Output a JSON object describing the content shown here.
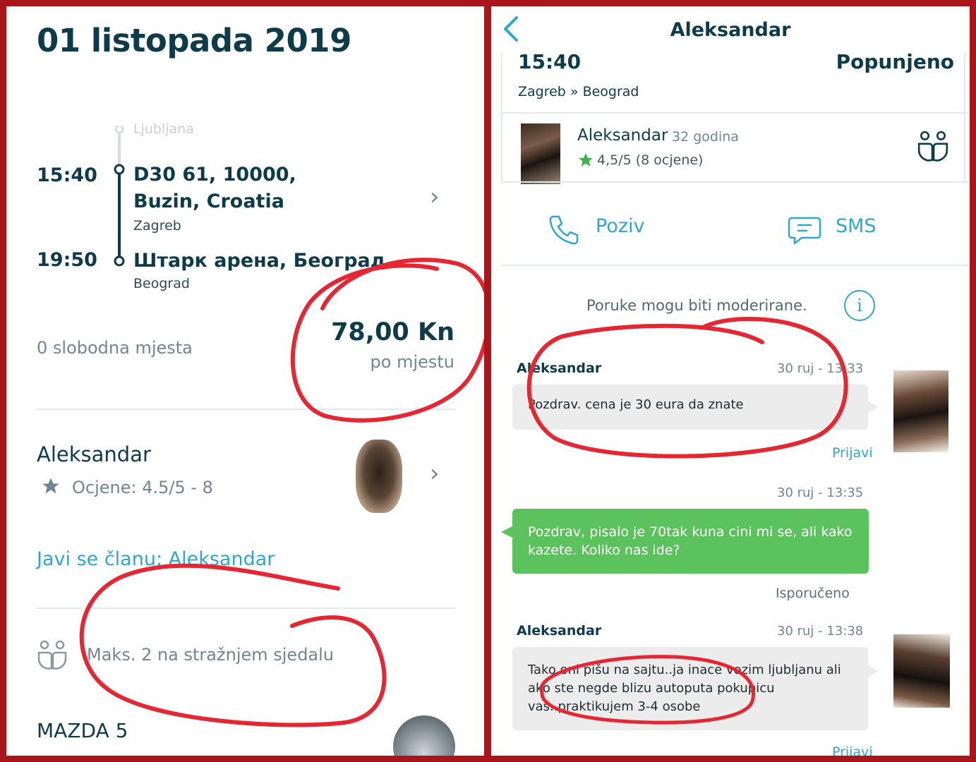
{
  "left": {
    "date_title": "01 listopada 2019",
    "route": {
      "origin_prev": "Ljubljana",
      "departure_time": "15:40",
      "departure_place_line1": "D30 61, 10000,",
      "departure_place_line2": "Buzin, Croatia",
      "departure_city": "Zagreb",
      "arrival_time": "19:50",
      "arrival_place": "Штарк арена, Београд",
      "arrival_city": "Beograd"
    },
    "seats_left": "0 slobodna mjesta",
    "price": "78,00 Kn",
    "price_unit": "po mjestu",
    "driver": {
      "name": "Aleksandar",
      "rating": "Ocjene: 4.5/5 - 8"
    },
    "contact_link": "Javi se članu: Aleksandar",
    "back_seat_note": "Maks. 2 na stražnjem sjedalu",
    "car": "MAZDA 5",
    "icons": {
      "star": "star-icon",
      "chevron": "chevron-right-icon",
      "passengers": "two-passengers-icon"
    }
  },
  "right": {
    "header_title": "Aleksandar",
    "trip_time": "15:40",
    "trip_status": "Popunjeno",
    "trip_route": "Zagreb » Beograd",
    "driver": {
      "name": "Aleksandar",
      "age": "32 godina",
      "rating": "4,5/5 (8 ocjene)"
    },
    "actions": {
      "call": "Poziv",
      "sms": "SMS"
    },
    "moderation_note": "Poruke mogu biti moderirane.",
    "messages": [
      {
        "author": "Aleksandar",
        "time": "30 ruj - 13:33",
        "text": "Pozdrav. cena je 30 eura da znate",
        "report": "Prijavi"
      },
      {
        "author": "",
        "time": "30 ruj - 13:35",
        "text": "Pozdrav, pisalo je 70tak kuna cini mi se, ali kako kazete. Koliko nas ide?",
        "status": "Isporučeno"
      },
      {
        "author": "Aleksandar",
        "time": "30 ruj - 13:38",
        "text": "Tako oni pišu na sajtu..ja inace vozim ljubljanu ali ako ste negde blizu autoputa pokupicu vas..praktikujem 3-4 osobe",
        "report": "Prijavi"
      }
    ]
  },
  "colors": {
    "frame": "#a8151b",
    "primary_text": "#0d3b4a",
    "accent_blue": "#2ea7cc",
    "sent_bubble": "#5cc25e",
    "received_bubble": "#ececec",
    "star": "#2a9d8f",
    "annotation_red": "#e52633"
  }
}
